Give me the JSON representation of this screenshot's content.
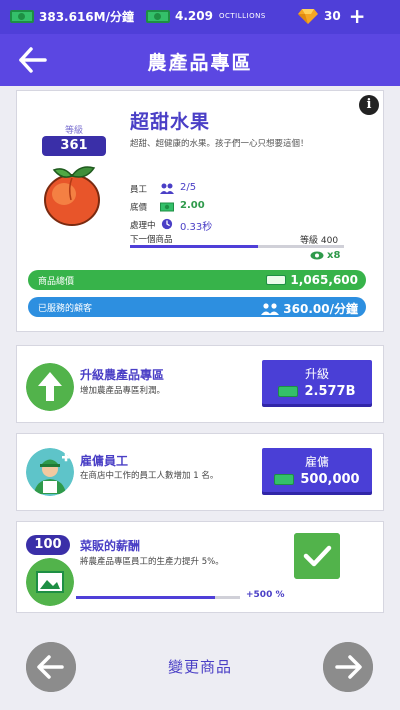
{
  "topbar": {
    "cash_rate": "383.616M/分鐘",
    "octillions_value": "4.209",
    "octillions_unit": "OCTILLIONS",
    "gems": "30",
    "plus": "+"
  },
  "header": {
    "title": "農產品專區"
  },
  "product": {
    "level_label": "等級",
    "level": "361",
    "name": "超甜水果",
    "description": "超甜、超健康的水果。孩子們一心只想要這個！",
    "workers_label": "員工",
    "workers_value": "2/5",
    "price_label": "底價",
    "price_value": "2.00",
    "processing_label": "處理中",
    "processing_value": "0.33秒",
    "next_label": "下一個商品",
    "next_level": "等級 400",
    "next_progress": 0.6,
    "multiplier": "x8",
    "total_price_label": "商品總價",
    "total_price_value": "1,065,600",
    "served_label": "已服務的顧客",
    "served_value": "360.00/分鐘"
  },
  "upgrade": {
    "title": "升級農產品專區",
    "description": "增加農產品專區利潤。",
    "button_label": "升級",
    "button_cost": "2.577B"
  },
  "hire": {
    "title": "雇傭員工",
    "description": "在商店中工作的員工人數增加 1 名。",
    "button_label": "雇傭",
    "button_cost": "500,000"
  },
  "salary": {
    "level": "100",
    "title": "菜販的薪酬",
    "description": "將農產品專區員工的生產力提升 5%。",
    "progress": 0.85,
    "progress_label": "+500 %"
  },
  "footer": {
    "change_label": "變更商品"
  },
  "colors": {
    "primary": "#5b47e2",
    "green": "#37b34a",
    "blue": "#2d8fe0",
    "navy": "#3a2fa8"
  }
}
